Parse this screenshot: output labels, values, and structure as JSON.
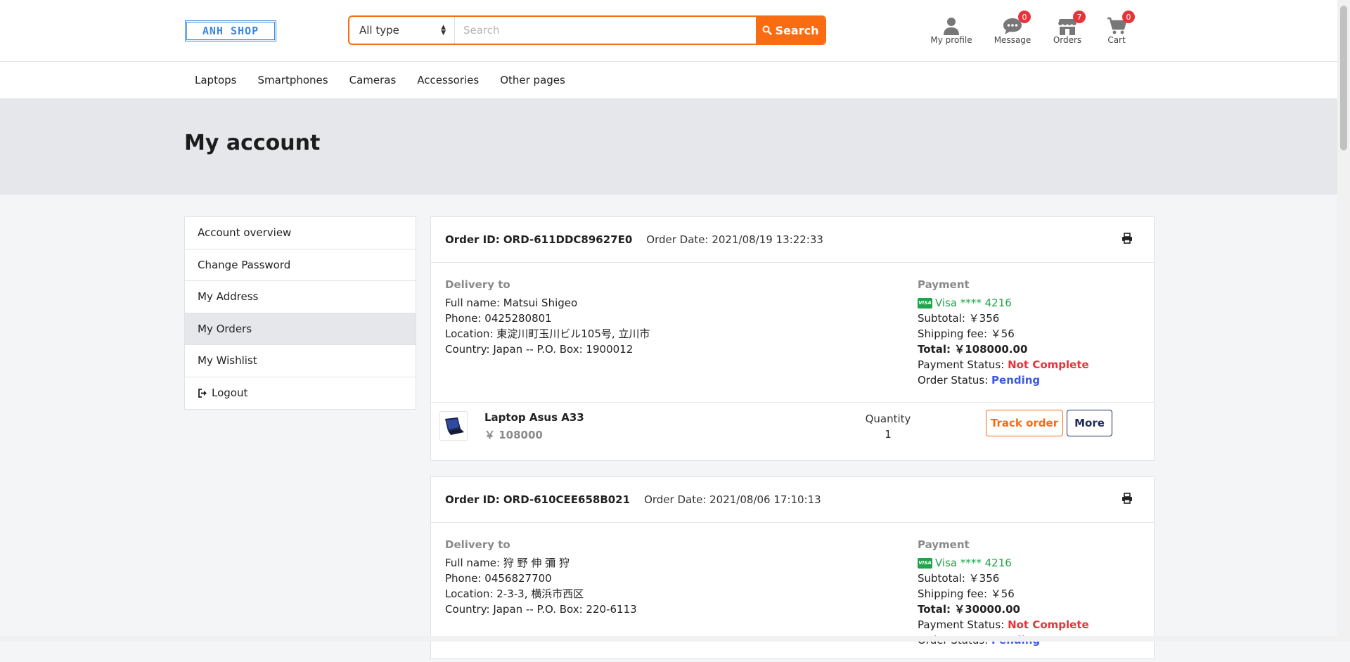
{
  "header": {
    "logo": "ANH SHOP",
    "search": {
      "type_value": "All type",
      "placeholder": "Search",
      "button_label": "Search"
    },
    "icons": [
      {
        "label": "My profile",
        "icon": "user-icon",
        "badge": null
      },
      {
        "label": "Message",
        "icon": "chat-icon",
        "badge": "0"
      },
      {
        "label": "Orders",
        "icon": "store-icon",
        "badge": "7"
      },
      {
        "label": "Cart",
        "icon": "cart-icon",
        "badge": "0"
      }
    ]
  },
  "nav": {
    "items": [
      "Laptops",
      "Smartphones",
      "Cameras",
      "Accessories",
      "Other pages"
    ]
  },
  "page": {
    "title": "My account"
  },
  "sidebar": {
    "items": [
      "Account overview",
      "Change Password",
      "My Address",
      "My Orders",
      "My Wishlist",
      "Logout"
    ],
    "active": "My Orders"
  },
  "orders": [
    {
      "id": "Order ID: ORD-611DDC89627E0",
      "date": "Order Date: 2021/08/19 13:22:33",
      "delivery_title": "Delivery to",
      "full_name": "Full name: Matsui Shigeo",
      "phone": "Phone: 0425280801",
      "location": "Location: 東淀川町玉川ビル105号, 立川市",
      "country": "Country: Japan -- P.O. Box: 1900012",
      "payment_title": "Payment",
      "card": "Visa **** 4216",
      "subtotal": "Subtotal: ￥356",
      "shipping": "Shipping fee: ￥56",
      "total": "Total: ￥108000.00",
      "payment_status_label": "Payment Status:",
      "payment_status": "Not Complete",
      "order_status_label": "Order Status:",
      "order_status": "Pending",
      "item": {
        "name": "Laptop Asus A33",
        "price": "￥ 108000",
        "qty_label": "Quantity",
        "qty": "1",
        "track_label": "Track order",
        "more_label": "More"
      }
    },
    {
      "id": "Order ID: ORD-610CEE658B021",
      "date": "Order Date: 2021/08/06 17:10:13",
      "delivery_title": "Delivery to",
      "full_name": "Full name: 狩 野 伸 彌 狩",
      "phone": "Phone: 0456827700",
      "location": "Location: 2-3-3, 横浜市西区",
      "country": "Country: Japan -- P.O. Box: 220-6113",
      "payment_title": "Payment",
      "card": "Visa **** 4216",
      "subtotal": "Subtotal: ￥356",
      "shipping": "Shipping fee: ￥56",
      "total": "Total: ￥30000.00",
      "payment_status_label": "Payment Status:",
      "payment_status": "Not Complete",
      "order_status_label": "Order Status:",
      "order_status": "Pending"
    }
  ],
  "colors": {
    "accent": "#f96c12",
    "badge": "#e8333a",
    "visa_green": "#1fa64a",
    "status_blue": "#3b5bdb"
  }
}
